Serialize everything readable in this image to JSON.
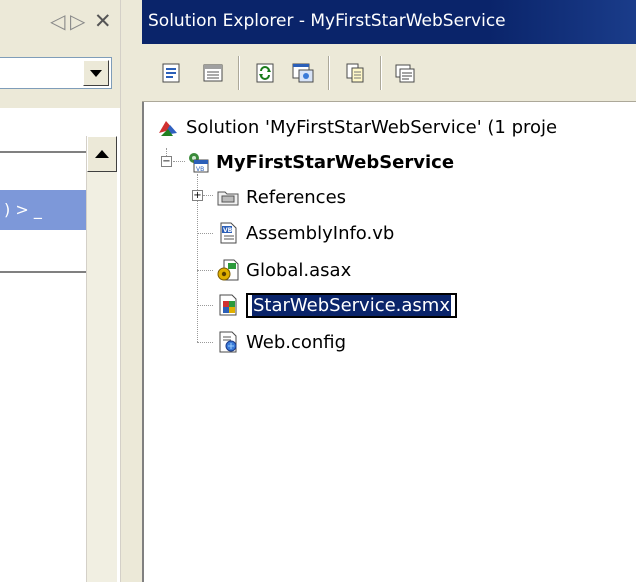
{
  "left_pane": {
    "nav_prev": "◁",
    "nav_next": "▷",
    "nav_close": "✕",
    "selected_row_text": ") >  _"
  },
  "solution_explorer": {
    "title": "Solution Explorer - MyFirstStarWebService",
    "toolbar": {
      "buttons": [
        "properties-icon",
        "show-all-files-icon",
        "refresh-icon",
        "view-designer-icon",
        "copy-project-icon",
        "view-code-icon"
      ]
    },
    "tree": {
      "solution": {
        "label": "Solution 'MyFirstStarWebService' (1 proje",
        "icon": "solution-icon"
      },
      "project": {
        "label": "MyFirstStarWebService",
        "icon": "vb-project-icon",
        "expander": "−"
      },
      "items": [
        {
          "label": "References",
          "icon": "references-folder-icon",
          "expander": "+"
        },
        {
          "label": "AssemblyInfo.vb",
          "icon": "vb-file-icon"
        },
        {
          "label": "Global.asax",
          "icon": "global-asax-icon"
        },
        {
          "label": "StarWebService.asmx",
          "icon": "asmx-file-icon",
          "editing": true
        },
        {
          "label": "Web.config",
          "icon": "config-file-icon"
        }
      ]
    }
  },
  "colors": {
    "titlebar": "#0a246a",
    "selection": "#0a246a",
    "chrome": "#ece9d8",
    "left_selection": "#7d98d9"
  }
}
